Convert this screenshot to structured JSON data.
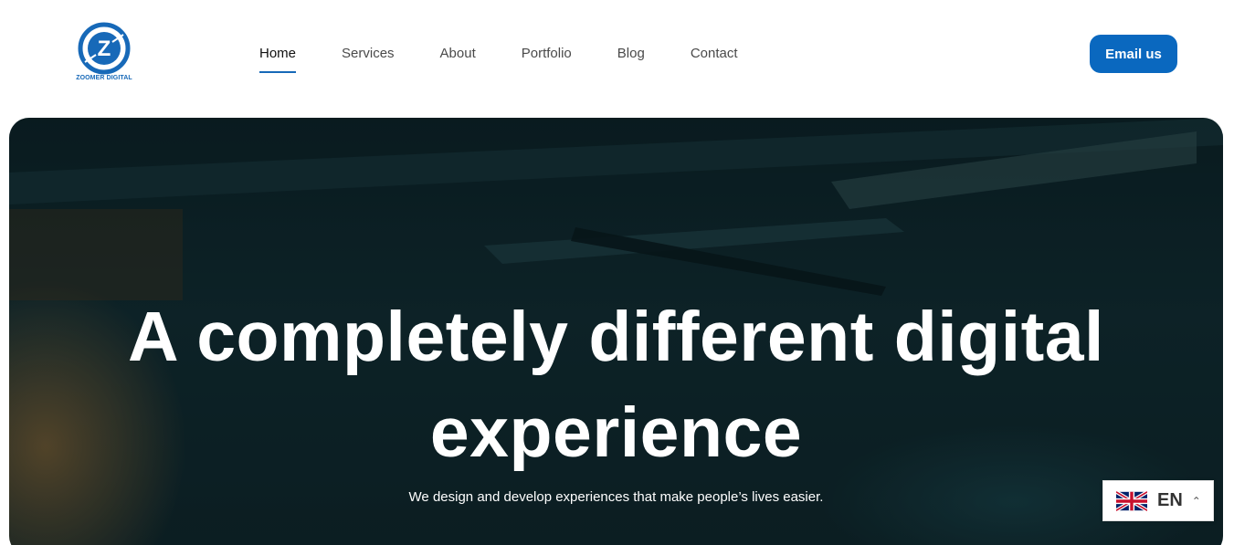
{
  "brand": {
    "name": "ZOOMER DIGITAL",
    "logo_letter": "Z",
    "logo_icon": "zoomer-logo-icon",
    "accent_color": "#1769b8"
  },
  "nav": {
    "items": [
      {
        "label": "Home",
        "active": true
      },
      {
        "label": "Services",
        "active": false
      },
      {
        "label": "About",
        "active": false
      },
      {
        "label": "Portfolio",
        "active": false
      },
      {
        "label": "Blog",
        "active": false
      },
      {
        "label": "Contact",
        "active": false
      }
    ]
  },
  "cta": {
    "label": "Email us",
    "color": "#0a68bf"
  },
  "hero": {
    "title_line1": "A completely different digital",
    "title_line2": "experience",
    "subtitle": "We design and develop experiences that make people’s lives easier."
  },
  "language": {
    "code": "EN",
    "flag_icon": "uk-flag-icon",
    "caret_icon": "chevron-up-icon"
  }
}
